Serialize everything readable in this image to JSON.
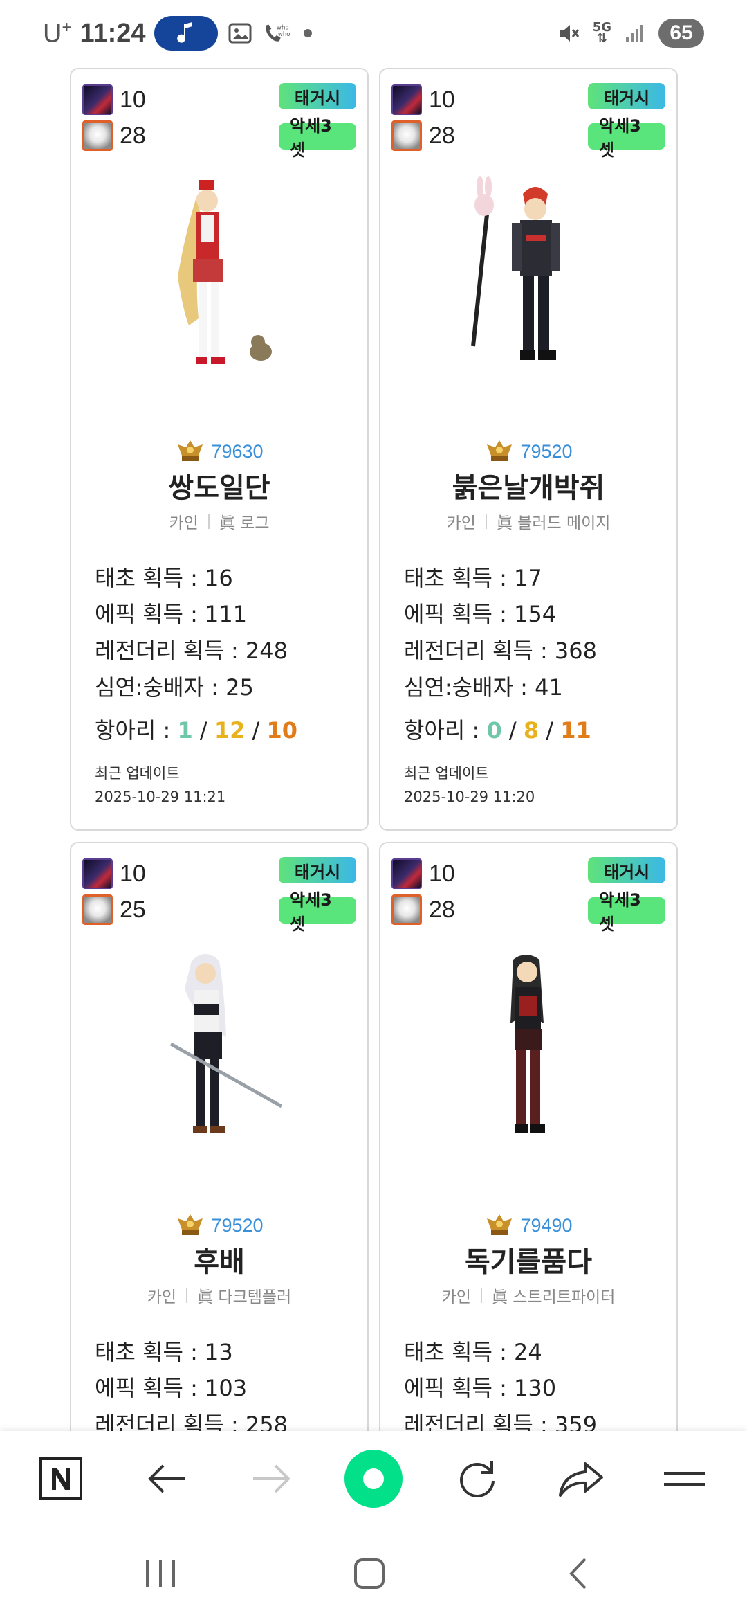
{
  "status_bar": {
    "carrier": "U",
    "carrier_sup": "+",
    "time": "11:24",
    "network": "5G",
    "battery": "65"
  },
  "badges": {
    "tag1": "태거시",
    "tag2": "악세3셋"
  },
  "cards": [
    {
      "stat1": "10",
      "stat2": "28",
      "fame": "79630",
      "name": "쌍도일단",
      "server": "카인",
      "job": "眞 로그",
      "taecho": "태초 획득 : 16",
      "epic": "에픽 획득 : 111",
      "legendary": "레전더리 획득 : 248",
      "abyss": "심연:숭배자 : 25",
      "jar_label": "항아리 : ",
      "jar_a": "1",
      "jar_b": "12",
      "jar_c": "10",
      "updated_label": "최근 업데이트",
      "updated_time": "2025-10-29 11:21"
    },
    {
      "stat1": "10",
      "stat2": "28",
      "fame": "79520",
      "name": "붉은날개박쥐",
      "server": "카인",
      "job": "眞 블러드 메이지",
      "taecho": "태초 획득 : 17",
      "epic": "에픽 획득 : 154",
      "legendary": "레전더리 획득 : 368",
      "abyss": "심연:숭배자 : 41",
      "jar_label": "항아리 : ",
      "jar_a": "0",
      "jar_b": "8",
      "jar_c": "11",
      "updated_label": "최근 업데이트",
      "updated_time": "2025-10-29 11:20"
    },
    {
      "stat1": "10",
      "stat2": "25",
      "fame": "79520",
      "name": "후배",
      "server": "카인",
      "job": "眞 다크템플러",
      "taecho": "태초 획득 : 13",
      "epic": "에픽 획득 : 103",
      "legendary": "레전더리 획득 : 258"
    },
    {
      "stat1": "10",
      "stat2": "28",
      "fame": "79490",
      "name": "독기를품다",
      "server": "카인",
      "job": "眞 스트리트파이터",
      "taecho": "태초 획득 : 24",
      "epic": "에픽 획득 : 130",
      "legendary": "레전더리 획득 : 359"
    }
  ],
  "browser_nav": {
    "icons": [
      "naver-n-icon",
      "back-arrow-icon",
      "forward-arrow-icon",
      "home-circle-icon",
      "refresh-icon",
      "share-icon",
      "menu-icon"
    ]
  },
  "system_nav": {
    "icons": [
      "recent-apps-icon",
      "home-icon",
      "back-icon"
    ]
  },
  "colors": {
    "fame": "#3a8fd9",
    "jar_teal": "#6fc6a8",
    "jar_yellow": "#e8b21f",
    "jar_orange": "#e07d1a",
    "badge_green": "#59e57c",
    "home_button": "#03e08a"
  }
}
